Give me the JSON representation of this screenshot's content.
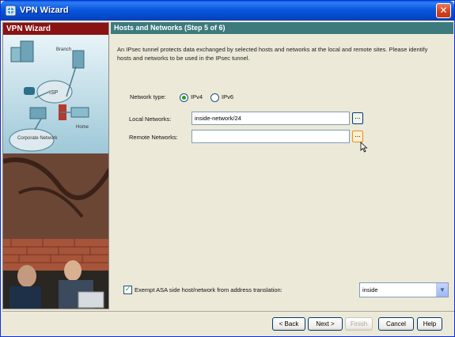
{
  "window": {
    "title": "VPN Wizard",
    "close_label": "✕"
  },
  "left_panel": {
    "header": "VPN Wizard",
    "diagram": {
      "branch_label": "Branch",
      "isp_label": "ISP",
      "home_label": "Home",
      "corporate_label": "Corporate Network"
    }
  },
  "step": {
    "header": "Hosts and Networks   (Step 5 of 6)",
    "intro": "An IPsec tunnel protects data exchanged by selected hosts and networks at the local and remote sites. Please identify hosts and networks to be used in the IPsec tunnel."
  },
  "form": {
    "network_type_label": "Network type:",
    "ipv4_label": "IPv4",
    "ipv6_label": "IPv6",
    "selected_type": "IPv4",
    "local_label": "Local Networks:",
    "local_value": "inside-network/24",
    "remote_label": "Remote Networks:",
    "remote_value": "",
    "browse_label": "...",
    "exempt_label": "Exempt ASA side host/network from address translation:",
    "exempt_checked": true,
    "interface_value": "inside"
  },
  "buttons": {
    "back": "< Back",
    "next": "Next >",
    "finish": "Finish",
    "cancel": "Cancel",
    "help": "Help"
  }
}
